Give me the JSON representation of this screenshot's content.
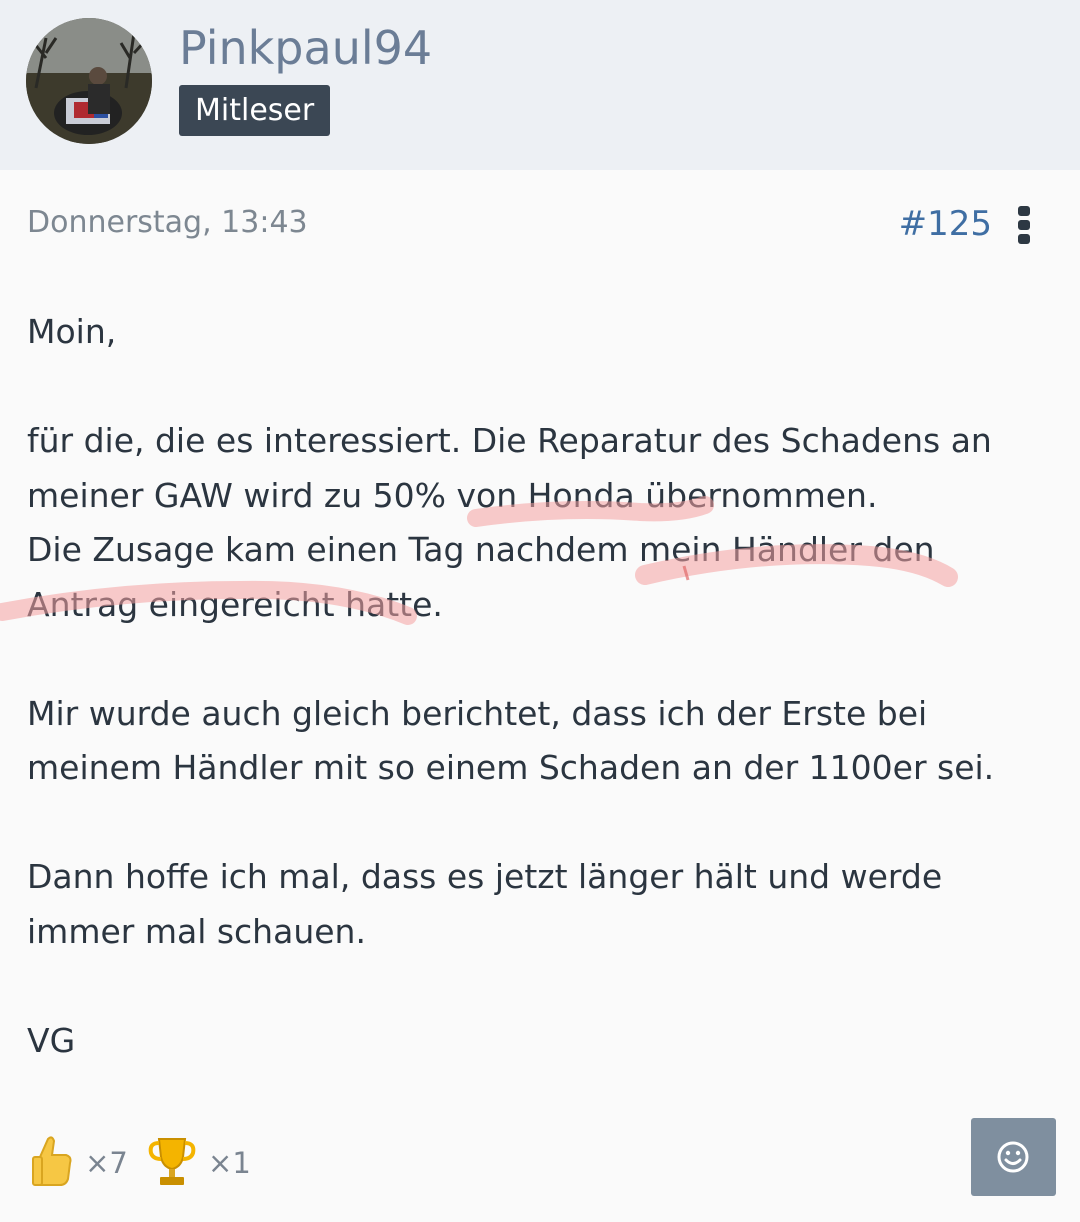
{
  "author": {
    "username": "Pinkpaul94",
    "role": "Mitleser"
  },
  "post": {
    "date": "Donnerstag, 13:43",
    "number": "#125",
    "lines": {
      "greeting": "Moin,",
      "p1_l1": "für die, die es interessiert. Die Reparatur des Schadens an",
      "p1_l2": "meiner GAW wird zu 50% von Honda übernommen.",
      "p1_l3": "Die Zusage kam einen Tag nachdem mein Händler den",
      "p1_l4": "Antrag eingereicht hatte.",
      "p2_l1": "Mir wurde auch gleich berichtet, dass ich der Erste bei",
      "p2_l2": "meinem Händler mit so einem Schaden an der 1100er sei.",
      "p3_l1": "Dann hoffe ich mal, dass es jetzt länger hält und werde",
      "p3_l2": "immer mal schauen.",
      "signoff": "VG"
    }
  },
  "reactions": [
    {
      "icon": "thumbs-up-icon",
      "count": "×7"
    },
    {
      "icon": "trophy-icon",
      "count": "×1"
    }
  ],
  "colors": {
    "header_bg": "#edf0f4",
    "username": "#6b7d96",
    "badge_bg": "#3b4754",
    "post_number": "#3f6ea3",
    "highlight": "#f4a0a0",
    "react_button": "#7f8f9f"
  }
}
